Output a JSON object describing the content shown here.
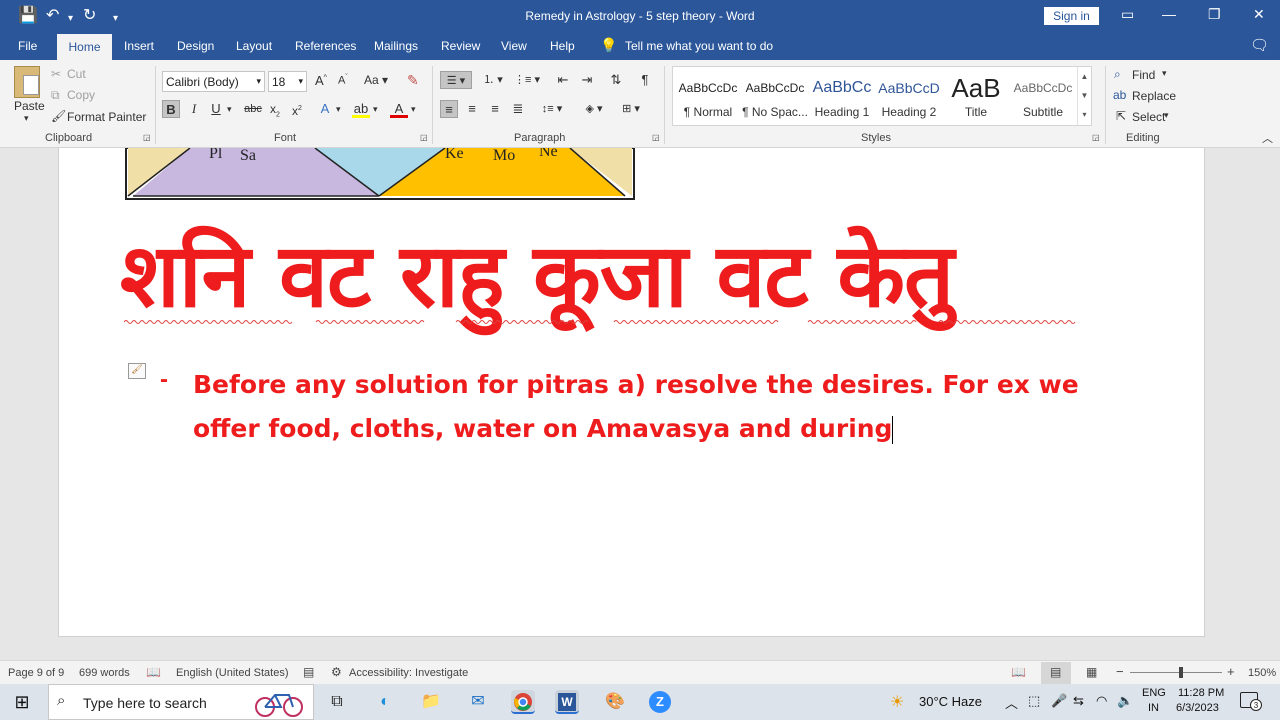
{
  "window": {
    "title": "Remedy in Astrology - 5 step theory  -  Word",
    "signin": "Sign in"
  },
  "menu": {
    "file": "File",
    "home": "Home",
    "insert": "Insert",
    "design": "Design",
    "layout": "Layout",
    "references": "References",
    "mailings": "Mailings",
    "review": "Review",
    "view": "View",
    "help": "Help",
    "tell": "Tell me what you want to do"
  },
  "clipboard": {
    "paste": "Paste",
    "cut": "Cut",
    "copy": "Copy",
    "format_painter": "Format Painter",
    "label": "Clipboard"
  },
  "font": {
    "name": "Calibri (Body)",
    "size": "18",
    "label": "Font"
  },
  "paragraph": {
    "label": "Paragraph"
  },
  "styles": {
    "label": "Styles",
    "items": [
      {
        "preview": "AaBbCcDc",
        "name": "¶ Normal"
      },
      {
        "preview": "AaBbCcDc",
        "name": "¶ No Spac..."
      },
      {
        "preview": "AaBbCc",
        "name": "Heading 1"
      },
      {
        "preview": "AaBbCcD",
        "name": "Heading 2"
      },
      {
        "preview": "AaB",
        "name": "Title"
      },
      {
        "preview": "AaBbCcDc",
        "name": "Subtitle"
      }
    ]
  },
  "editing": {
    "find": "Find",
    "replace": "Replace",
    "select": "Select",
    "label": "Editing"
  },
  "document": {
    "chart_labels": {
      "pl": "Pl",
      "sa": "Sa",
      "ke": "Ke",
      "mo": "Mo",
      "ne": "Ne"
    },
    "hindi_heading": "शनि वट राहु कूजा वट केतु",
    "bullet": "-",
    "paragraph": "Before any solution for pitras a) resolve the desires. For ex we offer food, cloths, water on Amavasya and during"
  },
  "status": {
    "page": "Page 9 of 9",
    "words": "699 words",
    "language": "English (United States)",
    "accessibility": "Accessibility: Investigate",
    "zoom": "150%"
  },
  "taskbar": {
    "search_placeholder": "Type here to search",
    "weather": "30°C  Haze",
    "lang1": "ENG",
    "lang2": "IN",
    "time": "11:28 PM",
    "date": "6/3/2023",
    "notif_count": "3"
  }
}
